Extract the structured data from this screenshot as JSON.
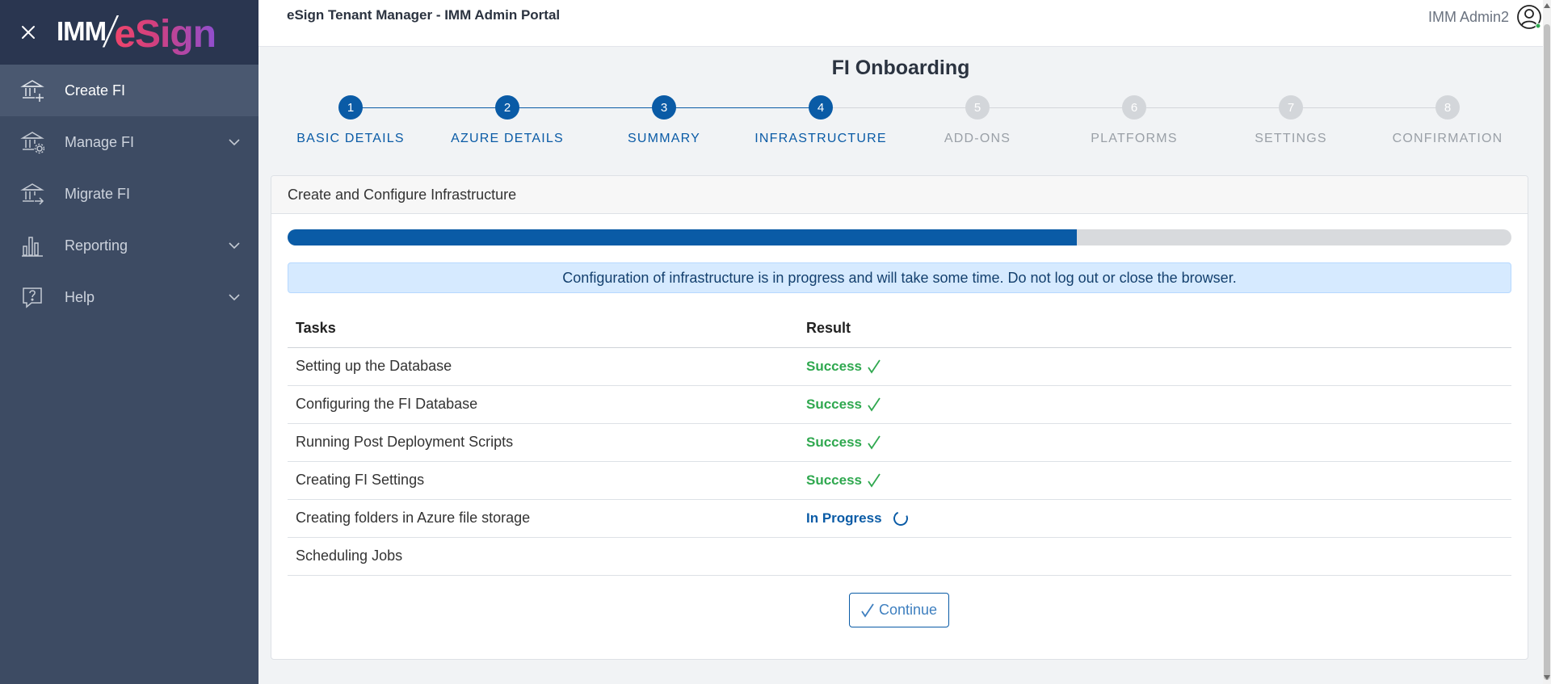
{
  "header": {
    "portal_title": "eSign Tenant Manager - IMM Admin Portal",
    "user_name": "IMM Admin2",
    "status_color": "#2fa84f"
  },
  "logo": {
    "part1": "IMM",
    "part2": "eSign"
  },
  "sidebar": {
    "items": [
      {
        "label": "Create FI",
        "icon": "bank-plus-icon",
        "active": true
      },
      {
        "label": "Manage FI",
        "icon": "bank-gear-icon",
        "expandable": true
      },
      {
        "label": "Migrate FI",
        "icon": "bank-arrow-icon"
      },
      {
        "label": "Reporting",
        "icon": "bar-chart-icon",
        "expandable": true
      },
      {
        "label": "Help",
        "icon": "help-icon",
        "expandable": true
      }
    ]
  },
  "page": {
    "title": "FI Onboarding"
  },
  "stepper": {
    "current": 4,
    "steps": [
      {
        "num": "1",
        "label": "BASIC DETAILS"
      },
      {
        "num": "2",
        "label": "AZURE DETAILS"
      },
      {
        "num": "3",
        "label": "SUMMARY"
      },
      {
        "num": "4",
        "label": "INFRASTRUCTURE"
      },
      {
        "num": "5",
        "label": "ADD-ONS"
      },
      {
        "num": "6",
        "label": "PLATFORMS"
      },
      {
        "num": "7",
        "label": "SETTINGS"
      },
      {
        "num": "8",
        "label": "CONFIRMATION"
      }
    ]
  },
  "card": {
    "title": "Create and Configure Infrastructure",
    "progress_percent": 64.5,
    "alert": "Configuration of infrastructure is in progress and will take some time. Do not log out or close the browser.",
    "table": {
      "headers": [
        "Tasks",
        "Result"
      ],
      "rows": [
        {
          "task": "Setting up the Database",
          "result": "Success",
          "status": "success"
        },
        {
          "task": "Configuring the FI Database",
          "result": "Success",
          "status": "success"
        },
        {
          "task": "Running Post Deployment Scripts",
          "result": "Success",
          "status": "success"
        },
        {
          "task": "Creating FI Settings",
          "result": "Success",
          "status": "success"
        },
        {
          "task": "Creating folders in Azure file storage",
          "result": "In Progress",
          "status": "progress"
        },
        {
          "task": "Scheduling Jobs",
          "result": "",
          "status": "pending"
        }
      ]
    },
    "continue_label": "Continue"
  },
  "colors": {
    "primary": "#0a5ba6",
    "success": "#2fa84f",
    "sidebar": "#3d4b63"
  }
}
